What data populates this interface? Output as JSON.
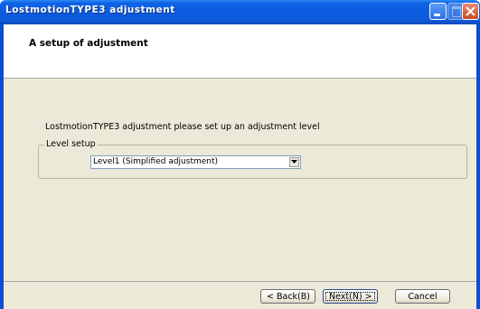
{
  "window": {
    "title": "LostmotionTYPE3 adjustment",
    "buttons": {
      "minimize_icon": "minimize-icon",
      "maximize_icon": "maximize-icon",
      "close_icon": "close-icon"
    }
  },
  "header": {
    "title": "A setup of adjustment"
  },
  "content": {
    "instruction": "LostmotionTYPE3 adjustment please set up an adjustment level",
    "level_group": {
      "label": "Level setup",
      "selected_value": "Level1 (Simplified adjustment)"
    }
  },
  "footer": {
    "back_label": "< Back(B)",
    "next_label": "Next(N) >",
    "cancel_label": "Cancel"
  },
  "colors": {
    "titlebar": "#0b5ae0",
    "dialog_background": "#ece9d8",
    "close_button": "#c94a22"
  }
}
